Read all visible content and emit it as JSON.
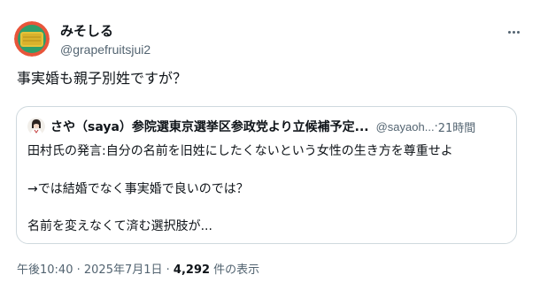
{
  "author": {
    "display_name": "みそしる",
    "handle": "@grapefruitsjui2"
  },
  "tweet": {
    "text": "事実婚も親子別姓ですが？"
  },
  "quote": {
    "display_name": "さや（saya）参院選東京選挙区参政党より立候補予定...",
    "handle": "@sayaoh...",
    "separator": " · ",
    "time": "21時間",
    "lines": [
      "田村氏の発言:自分の名前を旧姓にしたくないという女性の生き方を尊重せよ",
      "→では結婚でなく事実婚で良いのでは？",
      "名前を変えなくて済む選択肢が..."
    ]
  },
  "footer": {
    "time": "午後10:40",
    "dot1": " · ",
    "date": "2025年7月1日",
    "dot2": " · ",
    "views_count": "4,292",
    "views_label": " 件の表示"
  },
  "icons": {
    "more": "more-horizontal-icon"
  }
}
